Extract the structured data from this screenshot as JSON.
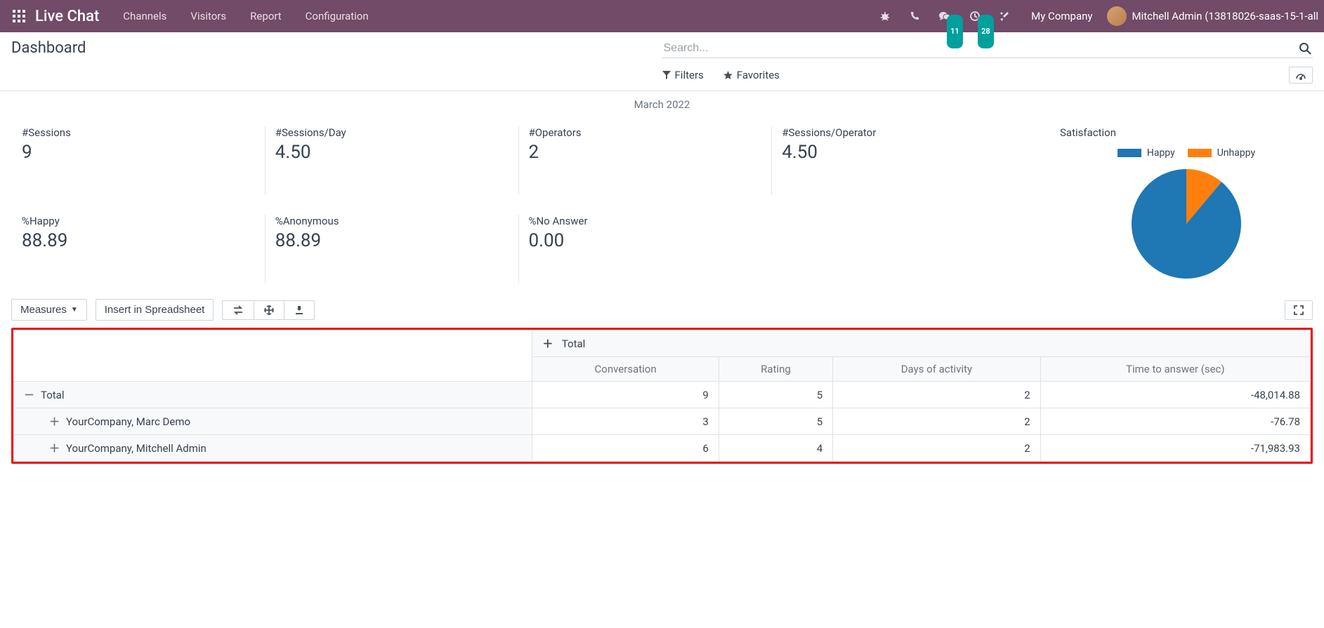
{
  "navbar": {
    "brand": "Live Chat",
    "menu": [
      "Channels",
      "Visitors",
      "Report",
      "Configuration"
    ],
    "badges": {
      "messages": "11",
      "activities": "28"
    },
    "company": "My Company",
    "user": "Mitchell Admin (13818026-saas-15-1-all"
  },
  "page": {
    "title": "Dashboard",
    "search_placeholder": "Search...",
    "filters_label": "Filters",
    "favorites_label": "Favorites",
    "period": "March 2022"
  },
  "cards": [
    {
      "label": "#Sessions",
      "value": "9"
    },
    {
      "label": "#Sessions/Day",
      "value": "4.50"
    },
    {
      "label": "#Operators",
      "value": "2"
    },
    {
      "label": "#Sessions/Operator",
      "value": "4.50"
    },
    {
      "label": "%Happy",
      "value": "88.89"
    },
    {
      "label": "%Anonymous",
      "value": "88.89"
    },
    {
      "label": "%No Answer",
      "value": "0.00"
    }
  ],
  "chart_data": {
    "type": "pie",
    "title": "Satisfaction",
    "series": [
      {
        "name": "Happy",
        "value": 88.89,
        "color": "#1f77b4"
      },
      {
        "name": "Unhappy",
        "value": 11.11,
        "color": "#ff7f0e"
      }
    ]
  },
  "toolbar": {
    "measures": "Measures",
    "insert": "Insert in Spreadsheet"
  },
  "pivot": {
    "col_group_label": "Total",
    "columns": [
      "Conversation",
      "Rating",
      "Days of activity",
      "Time to answer (sec)"
    ],
    "rows": [
      {
        "level": 0,
        "expanded": true,
        "label": "Total",
        "values": [
          "9",
          "5",
          "2",
          "-48,014.88"
        ]
      },
      {
        "level": 1,
        "expanded": false,
        "label": "YourCompany, Marc Demo",
        "values": [
          "3",
          "5",
          "2",
          "-76.78"
        ]
      },
      {
        "level": 1,
        "expanded": false,
        "label": "YourCompany, Mitchell Admin",
        "values": [
          "6",
          "4",
          "2",
          "-71,983.93"
        ]
      }
    ]
  }
}
